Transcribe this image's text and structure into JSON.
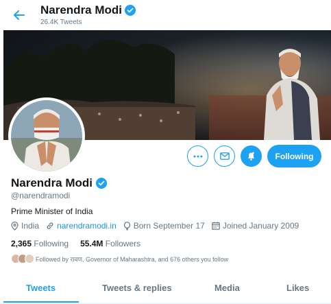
{
  "header": {
    "name": "Narendra Modi",
    "tweet_count": "26.4K Tweets"
  },
  "profile": {
    "name": "Narendra Modi",
    "handle": "@narendramodi",
    "bio": "Prime Minister of India",
    "location": "India",
    "website": "narendramodi.in",
    "born": "Born September 17",
    "joined": "Joined January 2009"
  },
  "stats": {
    "following_count": "2,365",
    "following_label": "Following",
    "followers_count": "55.4M",
    "followers_label": "Followers"
  },
  "followed_by": "Followed by रावण, Governor of Maharashtra, and 676 others you follow",
  "actions": {
    "follow_button": "Following"
  },
  "tabs": [
    "Tweets",
    "Tweets & replies",
    "Media",
    "Likes"
  ],
  "colors": {
    "accent": "#1da1f2",
    "link": "#1b95e0",
    "muted": "#657786"
  }
}
